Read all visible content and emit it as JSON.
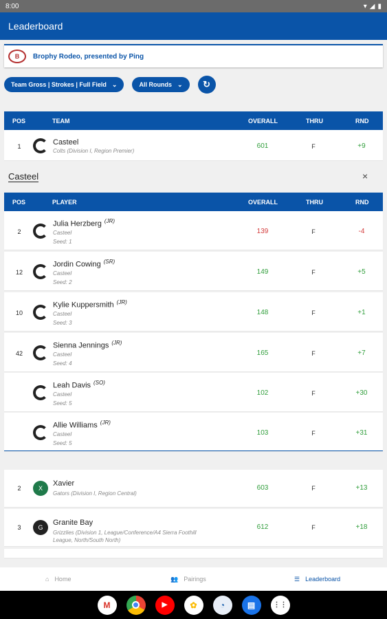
{
  "status": {
    "time": "8:00"
  },
  "app": {
    "title": "Leaderboard"
  },
  "event": {
    "name": "Brophy Rodeo, presented by Ping",
    "logo_text": "B"
  },
  "filters": {
    "scoring": "Team Gross | Strokes | Full Field",
    "rounds": "All Rounds"
  },
  "team_header": {
    "pos": "POS",
    "team": "TEAM",
    "overall": "OVERALL",
    "thru": "THRU",
    "rnd": "RND"
  },
  "top_team": {
    "pos": "1",
    "name": "Casteel",
    "sub": "Colts (Division I, Region Premier)",
    "overall": "601",
    "thru": "F",
    "rnd": "+9"
  },
  "section": {
    "title": "Casteel",
    "close": "×"
  },
  "player_header": {
    "pos": "POS",
    "player": "PLAYER",
    "overall": "OVERALL",
    "thru": "THRU",
    "rnd": "RND"
  },
  "players": [
    {
      "pos": "2",
      "name": "Julia Herzberg",
      "year": "(JR)",
      "school": "Casteel",
      "seed": "Seed: 1",
      "overall": "139",
      "thru": "F",
      "rnd": "-4",
      "overall_color": "red",
      "rnd_color": "red"
    },
    {
      "pos": "12",
      "name": "Jordin Cowing",
      "year": "(SR)",
      "school": "Casteel",
      "seed": "Seed: 2",
      "overall": "149",
      "thru": "F",
      "rnd": "+5",
      "overall_color": "green",
      "rnd_color": "green"
    },
    {
      "pos": "10",
      "name": "Kylie Kuppersmith",
      "year": "(JR)",
      "school": "Casteel",
      "seed": "Seed: 3",
      "overall": "148",
      "thru": "F",
      "rnd": "+1",
      "overall_color": "green",
      "rnd_color": "green"
    },
    {
      "pos": "42",
      "name": "Sienna Jennings",
      "year": "(JR)",
      "school": "Casteel",
      "seed": "Seed: 4",
      "overall": "165",
      "thru": "F",
      "rnd": "+7",
      "overall_color": "green",
      "rnd_color": "green"
    },
    {
      "pos": "",
      "name": "Leah Davis",
      "year": "(SO)",
      "school": "Casteel",
      "seed": "Seed: 5",
      "overall": "102",
      "thru": "F",
      "rnd": "+30",
      "overall_color": "green",
      "rnd_color": "green"
    },
    {
      "pos": "",
      "name": "Allie Williams",
      "year": "(JR)",
      "school": "Casteel",
      "seed": "Seed: 5",
      "overall": "103",
      "thru": "F",
      "rnd": "+31",
      "overall_color": "green",
      "rnd_color": "green"
    }
  ],
  "other_teams": [
    {
      "pos": "2",
      "name": "Xavier",
      "sub1": "Gators (Division I, Region Central)",
      "sub2": "",
      "overall": "603",
      "thru": "F",
      "rnd": "+13"
    },
    {
      "pos": "3",
      "name": "Granite Bay",
      "sub1": "Grizzlies (Division 1, League/Conference/A4 Sierra Foothill",
      "sub2": "League, North/South North)",
      "overall": "612",
      "thru": "F",
      "rnd": "+18"
    }
  ],
  "nav": {
    "home": "Home",
    "pairings": "Pairings",
    "leaderboard": "Leaderboard"
  },
  "dock": [
    "Gmail",
    "Chrome",
    "YouTube",
    "Photos",
    "Golf",
    "Messages",
    "Apps"
  ],
  "colors": {
    "primary": "#0a54a8",
    "green": "#2f9d3a",
    "red": "#d33b3b"
  }
}
